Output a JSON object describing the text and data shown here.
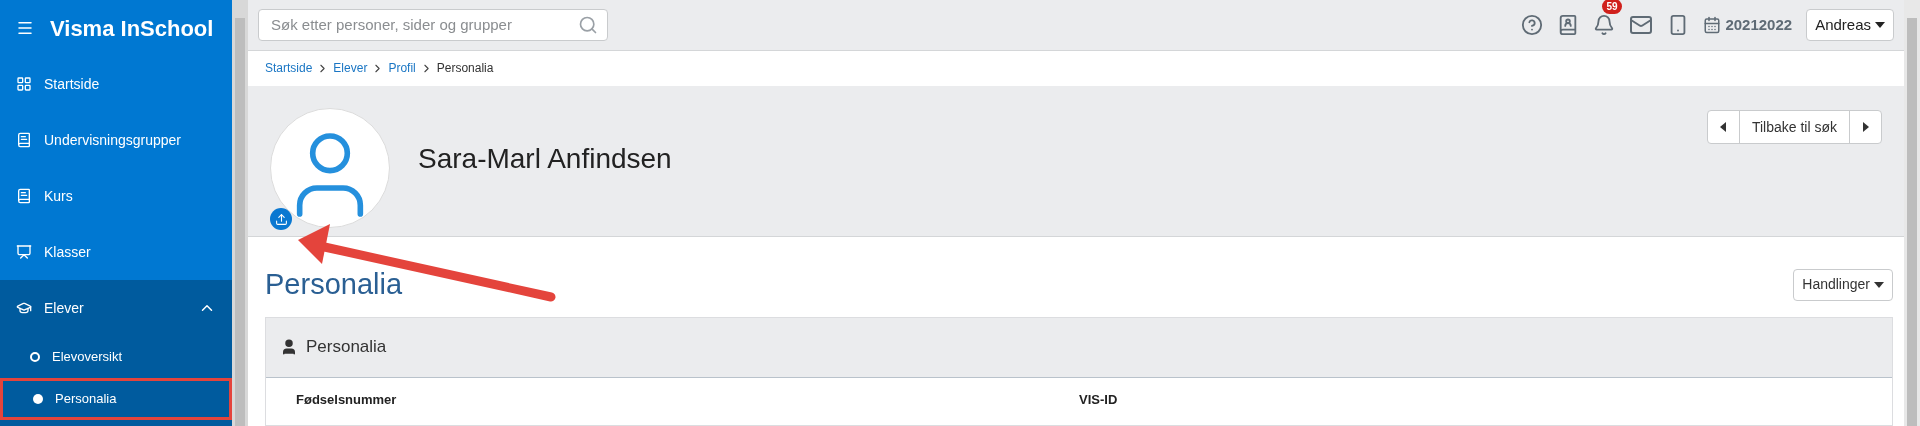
{
  "app": {
    "title": "Visma InSchool"
  },
  "sidebar": {
    "items": [
      {
        "label": "Startside"
      },
      {
        "label": "Undervisningsgrupper"
      },
      {
        "label": "Kurs"
      },
      {
        "label": "Klasser"
      },
      {
        "label": "Elever",
        "expanded": true,
        "children": [
          {
            "label": "Elevoversikt",
            "selected": false
          },
          {
            "label": "Personalia",
            "selected": true
          }
        ]
      }
    ]
  },
  "topbar": {
    "search": {
      "placeholder": "Søk etter personer, sider og grupper"
    },
    "notifications": "59",
    "school_year": "20212022",
    "user": "Andreas"
  },
  "breadcrumb": [
    "Startside",
    "Elever",
    "Profil",
    "Personalia"
  ],
  "profile": {
    "name": "Sara-Marl Anfindsen",
    "back_button": "Tilbake til søk"
  },
  "section": {
    "title": "Personalia",
    "actions": "Handlinger",
    "card": {
      "title": "Personalia",
      "fields": [
        "Fødselsnummer",
        "VIS-ID"
      ]
    }
  }
}
